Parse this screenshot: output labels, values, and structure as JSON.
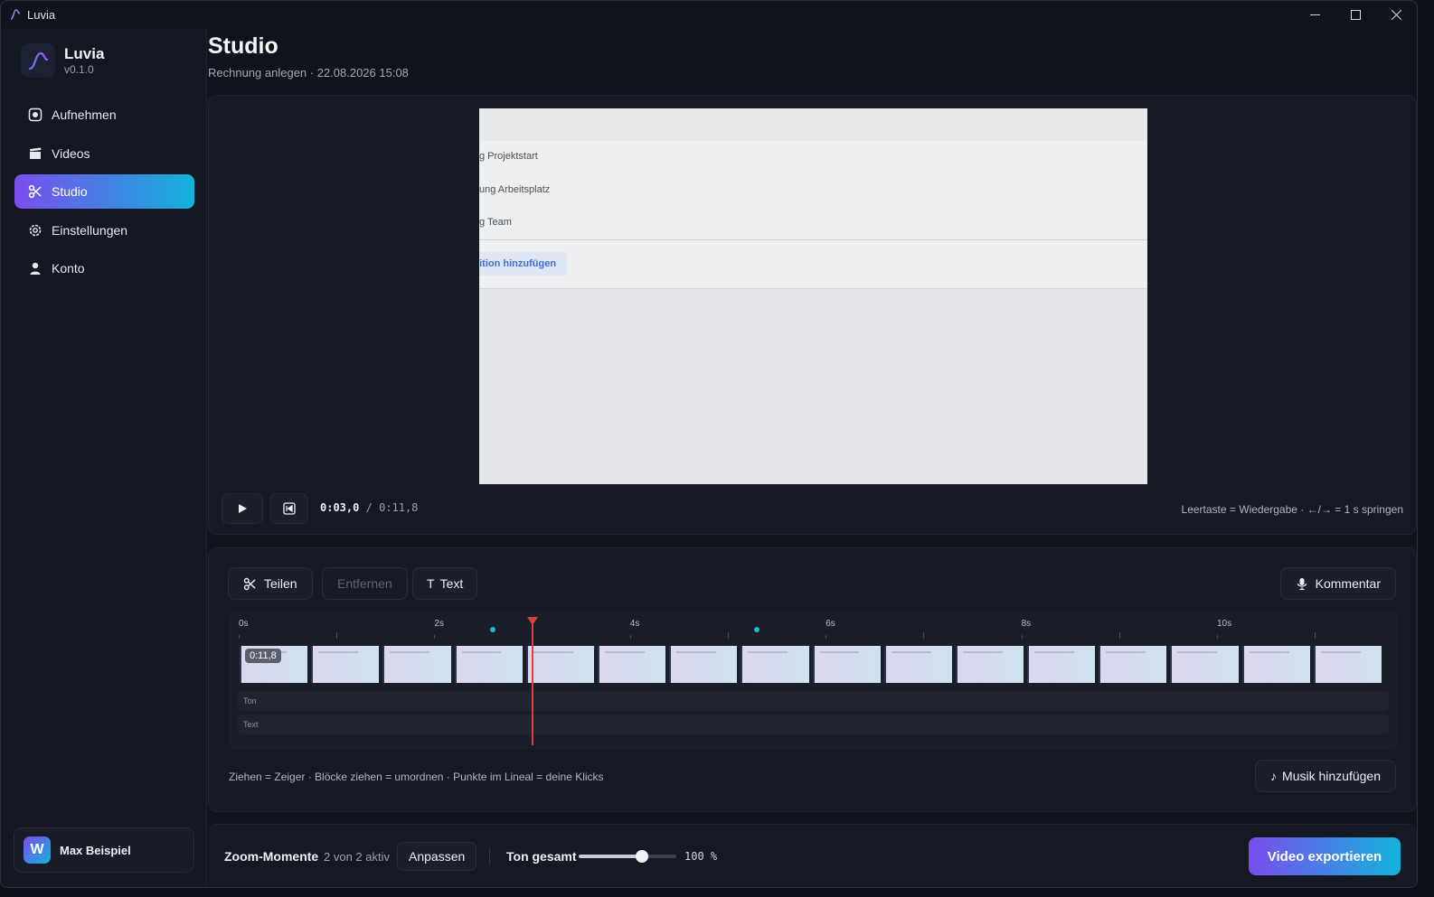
{
  "window": {
    "title": "Luvia"
  },
  "brand": {
    "name": "Luvia",
    "version": "v0.1.0"
  },
  "nav": [
    {
      "label": "Aufnehmen",
      "icon": "record-icon",
      "active": false
    },
    {
      "label": "Videos",
      "icon": "clapper-icon",
      "active": false
    },
    {
      "label": "Studio",
      "icon": "scissors-icon",
      "active": true
    },
    {
      "label": "Einstellungen",
      "icon": "gear-icon",
      "active": false
    },
    {
      "label": "Konto",
      "icon": "user-icon",
      "active": false
    }
  ],
  "user": {
    "initial": "W",
    "name": "Max Beispiel"
  },
  "page": {
    "title": "Studio",
    "subtitle": "Rechnung anlegen · 22.08.2026 15:08"
  },
  "preview": {
    "lines": [
      "g Projektstart",
      "ung Arbeitsplatz",
      "g Team"
    ],
    "button": "sition hinzufügen",
    "time_current": "0:03,0",
    "time_separator": "/",
    "time_total": "0:11,8",
    "hint": "Leertaste = Wiedergabe · ←/→ = 1 s springen"
  },
  "tools": {
    "split": "Teilen",
    "remove": "Entfernen",
    "text": "Text",
    "comment": "Kommentar",
    "music": "Musik hinzufügen"
  },
  "timeline": {
    "ruler_labels": [
      "0s",
      "2s",
      "4s",
      "6s",
      "8s",
      "10s"
    ],
    "duration_s": 11.8,
    "playhead_s": 3.0,
    "click_points_s": [
      2.6,
      5.3
    ],
    "clip_badge": "0:11,8",
    "frame_count": 16,
    "tracks": [
      "Ton",
      "Text"
    ],
    "hint": "Ziehen = Zeiger · Blöcke ziehen = umordnen · Punkte im Lineal = deine Klicks"
  },
  "bottom": {
    "zoom_label": "Zoom-Momente",
    "zoom_count": "2 von 2 aktiv",
    "adjust": "Anpassen",
    "volume_label": "Ton gesamt",
    "volume_value": "100 %",
    "volume_fraction": 0.65,
    "export": "Video exportieren"
  },
  "colors": {
    "accent_start": "#7b4dee",
    "accent_end": "#12b3db",
    "playhead": "#e0403a",
    "click_dot": "#1fb5d8"
  }
}
